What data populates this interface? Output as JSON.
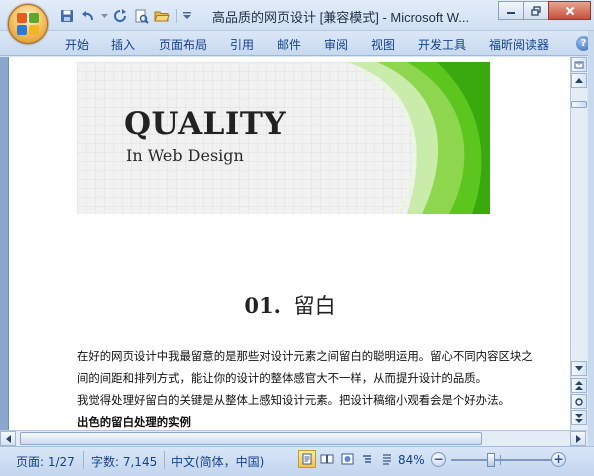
{
  "window": {
    "title": "高品质的网页设计 [兼容模式] - Microsoft W..."
  },
  "quick_access": {
    "icons": [
      "save-icon",
      "undo-icon",
      "redo-icon",
      "print-preview-icon",
      "open-folder-icon",
      "customize-qat-icon"
    ]
  },
  "ribbon": {
    "tabs": [
      "开始",
      "插入",
      "页面布局",
      "引用",
      "邮件",
      "审阅",
      "视图",
      "开发工具",
      "福昕阅读器"
    ]
  },
  "document": {
    "banner": {
      "title": "QUALITY",
      "subtitle": "In Web Design"
    },
    "heading": {
      "number": "01.",
      "text": "留白"
    },
    "paragraphs": [
      "在好的网页设计中我最留意的是那些对设计元素之间留白的聪明运用。留心不同内容区块之",
      "间的间距和排列方式，能让你的设计的整体感官大不一样，从而提升设计的品质。",
      "我觉得处理好留白的关键是从整体上感知设计元素。把设计稿缩小观看会是个好办法。"
    ],
    "bold_line": "出色的留白处理的实例"
  },
  "statusbar": {
    "page": "页面: 1/27",
    "words": "字数: 7,145",
    "language": "中文(简体，中国)",
    "zoom": "84%",
    "zoom_value": 84
  },
  "colors": {
    "ribbon_text": "#15428b",
    "doc_background": "#8aa8cd",
    "banner_green": "#5cc61e"
  }
}
